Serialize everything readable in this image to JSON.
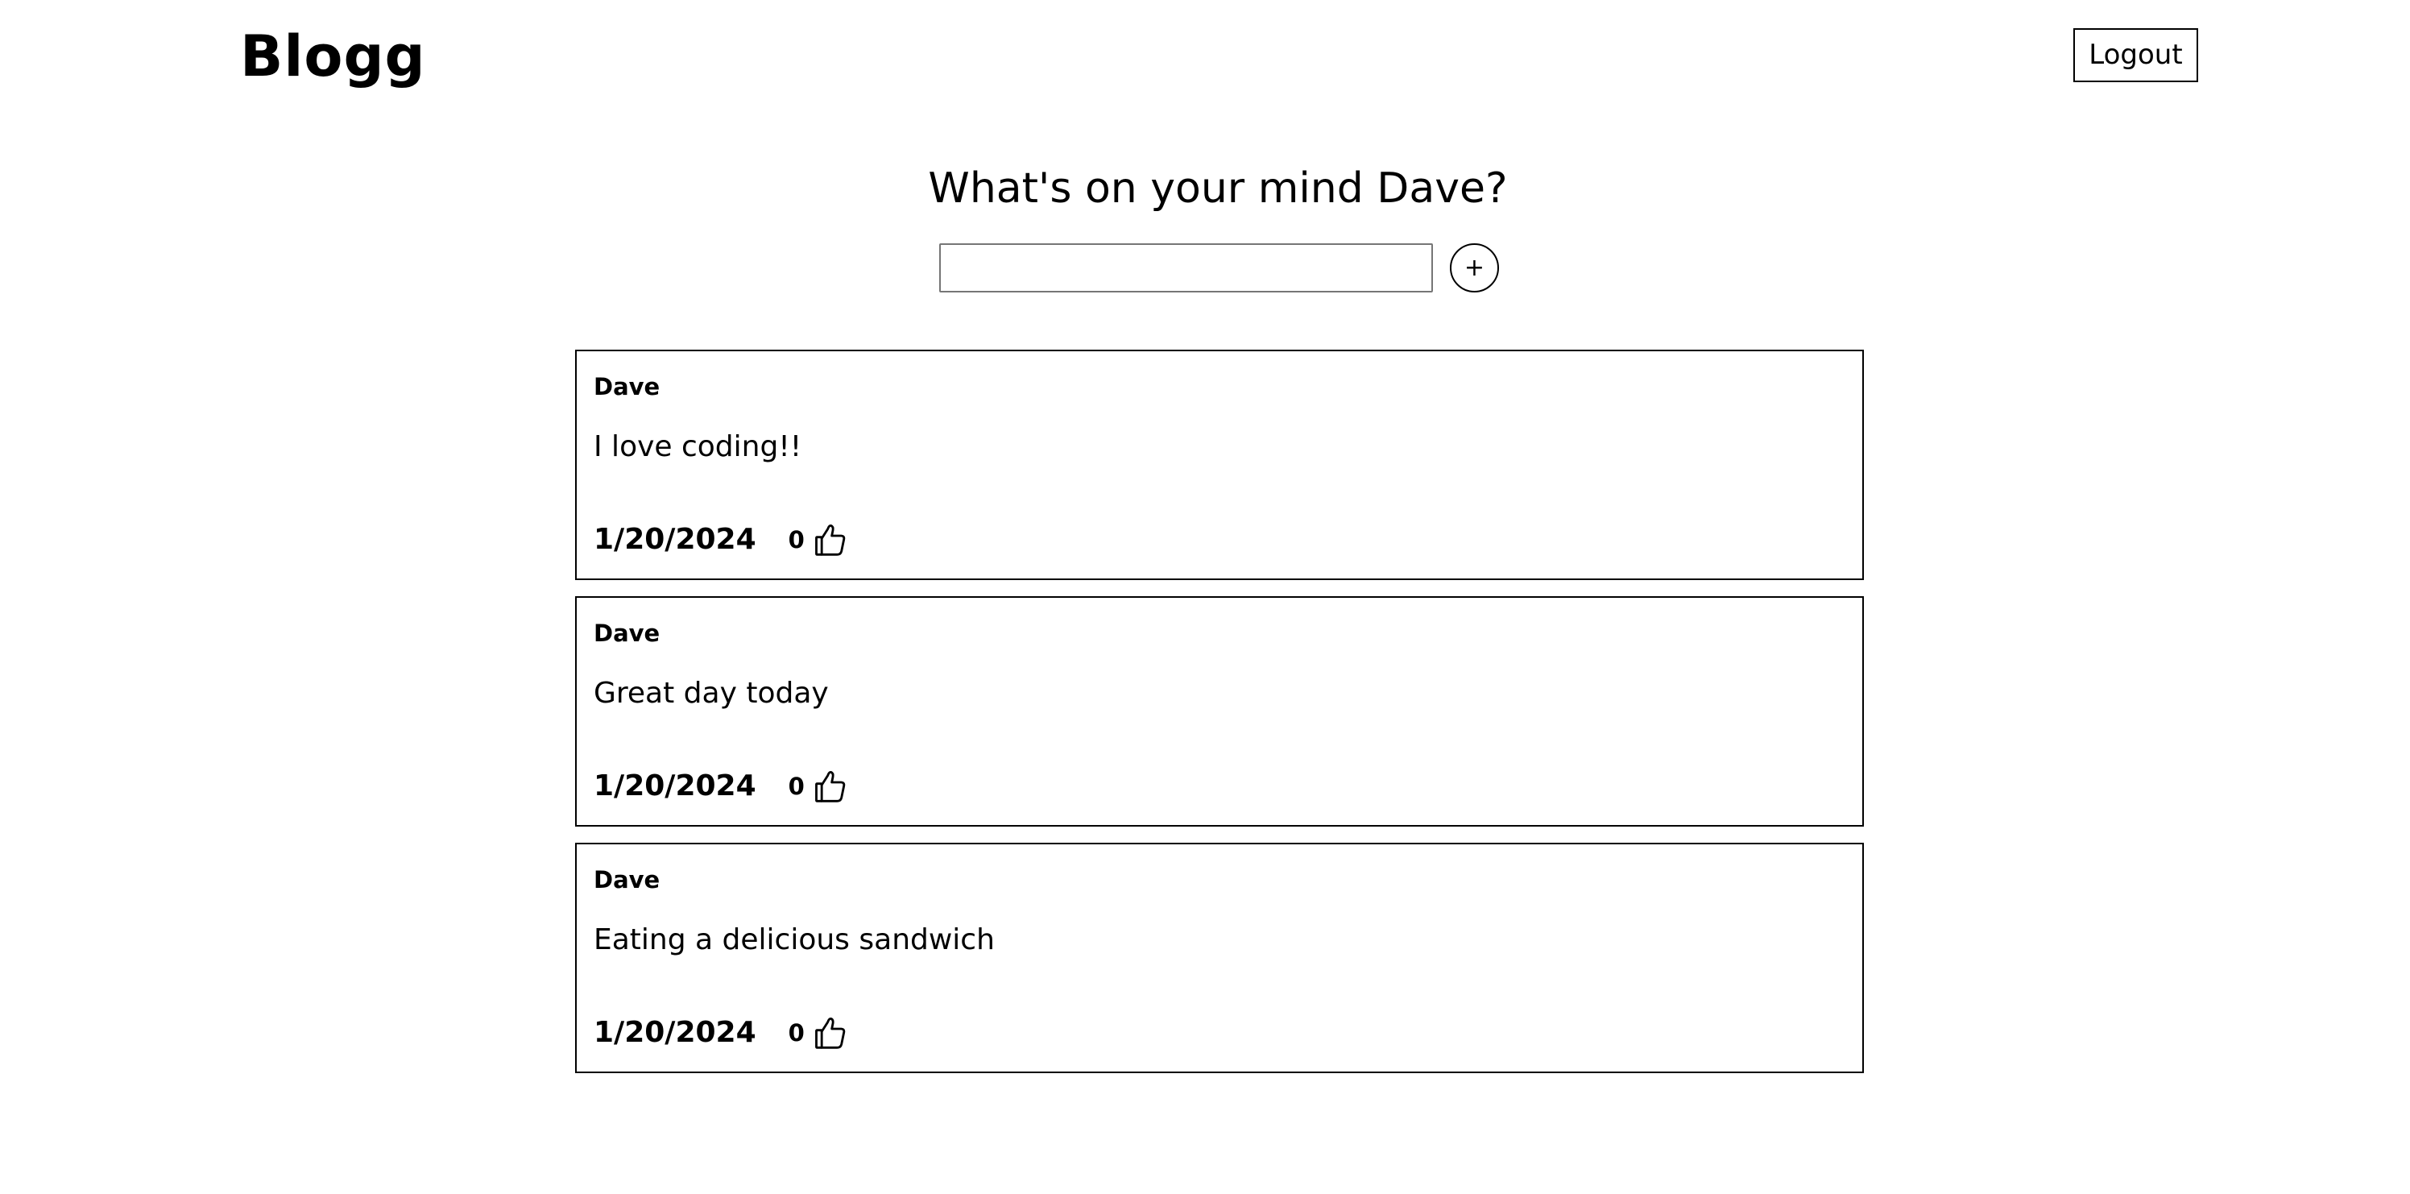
{
  "header": {
    "brand": "Blogg",
    "logout_label": "Logout"
  },
  "composer": {
    "heading": "What's on your mind Dave?",
    "input_value": "",
    "add_label": "+"
  },
  "posts": [
    {
      "author": "Dave",
      "body": "I love coding!!",
      "date": "1/20/2024",
      "likes": "0"
    },
    {
      "author": "Dave",
      "body": "Great day today",
      "date": "1/20/2024",
      "likes": "0"
    },
    {
      "author": "Dave",
      "body": "Eating a delicious sandwich",
      "date": "1/20/2024",
      "likes": "0"
    }
  ],
  "icons": {
    "like": "thumbs-up-icon"
  },
  "colors": {
    "background": "#ffffff",
    "text": "#000000",
    "border": "#000000",
    "input_border": "#767676"
  }
}
